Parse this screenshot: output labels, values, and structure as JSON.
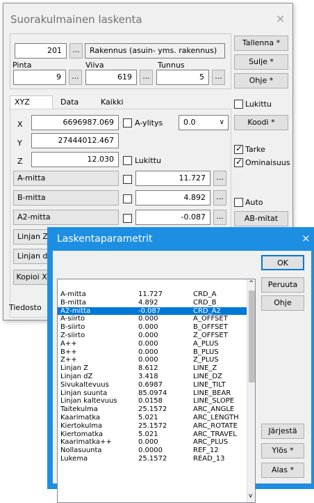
{
  "main": {
    "title": "Suorakulmainen laskenta",
    "close_glyph": "×",
    "code_value": "201",
    "code_desc": "Rakennus (asuin- yms. rakennus)",
    "ellipsis": "...",
    "pinta_label": "Pinta",
    "pinta_value": "9",
    "viiva_label": "Viiva",
    "viiva_value": "619",
    "tunnus_label": "Tunnus",
    "tunnus_value": "5",
    "buttons": {
      "tallenna": "Tallenna *",
      "sulje": "Sulje *",
      "ohje": "Ohje *",
      "koodi": "Koodi *",
      "abmitat": "AB-mitat",
      "kopioi": "Kopioi XY"
    },
    "tabs": [
      "XYZ",
      "Data",
      "Kaikki"
    ],
    "x_label": "X",
    "x_value": "6696987.069",
    "y_label": "Y",
    "y_value": "27444012.467",
    "z_label": "Z",
    "z_value": "12.030",
    "aylitys_label": "A-ylitys",
    "combo_value": "0.0",
    "lukittu_z_label": "Lukittu",
    "lukittu_label": "Lukittu",
    "tarke_label": "Tarke",
    "ominaisuus_label": "Ominaisuus",
    "auto_label": "Auto",
    "amitta_label": "A-mitta",
    "amitta_value": "11.727",
    "bmitta_label": "B-mitta",
    "bmitta_value": "4.892",
    "a2mitta_label": "A2-mitta",
    "a2mitta_value": "-0.087",
    "linjan_z_label": "Linjan Z",
    "linjan_dz_label": "Linjan dZ",
    "tiedosto_label": "Tiedosto"
  },
  "dialog": {
    "title": "Laskentaparametrit",
    "close_glyph": "×",
    "rows": [
      {
        "name": "A-mitta",
        "value": "11.727",
        "code": "CRD_A"
      },
      {
        "name": "B-mitta",
        "value": "4.892",
        "code": "CRD_B"
      },
      {
        "name": "A2-mitta",
        "value": "-0.087",
        "code": "CRD_A2"
      },
      {
        "name": "A-siirto",
        "value": "0.000",
        "code": "A_OFFSET"
      },
      {
        "name": "B-siirto",
        "value": "0.000",
        "code": "B_OFFSET"
      },
      {
        "name": "Z-siirto",
        "value": "0.000",
        "code": "Z_OFFSET"
      },
      {
        "name": "A++",
        "value": "0.000",
        "code": "A_PLUS"
      },
      {
        "name": "B++",
        "value": "0.000",
        "code": "B_PLUS"
      },
      {
        "name": "Z++",
        "value": "0.000",
        "code": "Z_PLUS"
      },
      {
        "name": "Linjan Z",
        "value": "8.612",
        "code": "LINE_Z"
      },
      {
        "name": "Linjan dZ",
        "value": "3.418",
        "code": "LINE_DZ"
      },
      {
        "name": "Sivukaltevuus",
        "value": "0.6987",
        "code": "LINE_TILT"
      },
      {
        "name": "Linjan suunta",
        "value": "85.0974",
        "code": "LINE_BEAR"
      },
      {
        "name": "Linjan kaltevuus",
        "value": "0.0158",
        "code": "LINE_SLOPE"
      },
      {
        "name": "Taitekulma",
        "value": "25.1572",
        "code": "ARC_ANGLE"
      },
      {
        "name": "Kaarimatka",
        "value": "5.021",
        "code": "ARC_LENGTH"
      },
      {
        "name": "Kiertokulma",
        "value": "25.1572",
        "code": "ARC_ROTATE"
      },
      {
        "name": "Kiertomatka",
        "value": "5.021",
        "code": "ARC_TRAVEL"
      },
      {
        "name": "Kaarimatka++",
        "value": "0.000",
        "code": "ARC_PLUS"
      },
      {
        "name": "Nollasuunta",
        "value": "0.0000",
        "code": "REF_12"
      },
      {
        "name": "Lukema",
        "value": "25.1572",
        "code": "READ_13"
      }
    ],
    "selected_index": 2,
    "buttons": {
      "ok": "OK",
      "peruuta": "Peruuta",
      "ohje": "Ohje",
      "jarjesta": "Järjestä",
      "ylos": "Ylös *",
      "alas": "Alas *"
    },
    "scroll_up": "^",
    "scroll_down": "v",
    "colors": {
      "title_bar": "#1d8fe3",
      "selection": "#0078d7"
    }
  }
}
